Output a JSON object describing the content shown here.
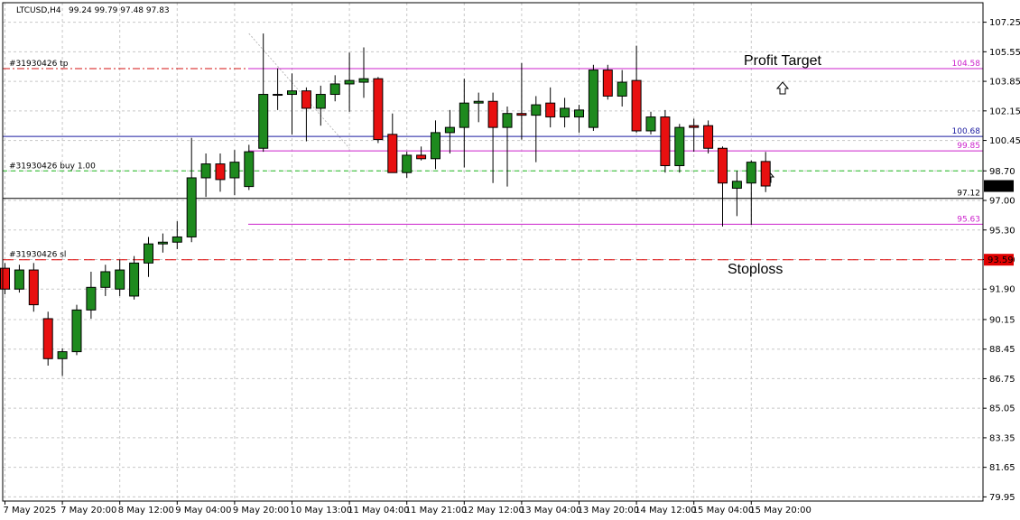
{
  "header": {
    "symbol": "LTCUSD,H4",
    "ohlc": "99.24 99.79 97.48 97.83"
  },
  "colors": {
    "bull": "#1e8a1e",
    "bear": "#e81010",
    "tp_line": "#d41010",
    "sl_line": "#e00000",
    "entry_line": "#22bb22",
    "magenta_line": "#cc22cc",
    "blue_line": "#1a1aa0",
    "price_line": "#000000",
    "grid": "#c8c8c8"
  },
  "chart_data": {
    "type": "candlestick",
    "ylim": [
      79.95,
      107.25
    ],
    "y_ticks": [
      "107.25",
      "105.55",
      "103.85",
      "102.15",
      "100.45",
      "98.70",
      "97.00",
      "95.30",
      "93.60",
      "91.90",
      "90.15",
      "88.45",
      "86.75",
      "85.05",
      "83.35",
      "81.65",
      "79.95"
    ],
    "x_ticks": [
      {
        "label": "7 May 2025",
        "i": 0
      },
      {
        "label": "7 May 20:00",
        "i": 4
      },
      {
        "label": "8 May 12:00",
        "i": 8
      },
      {
        "label": "9 May 04:00",
        "i": 12
      },
      {
        "label": "9 May 20:00",
        "i": 16
      },
      {
        "label": "10 May 13:00",
        "i": 20
      },
      {
        "label": "11 May 04:00",
        "i": 24
      },
      {
        "label": "11 May 21:00",
        "i": 28
      },
      {
        "label": "12 May 12:00",
        "i": 32
      },
      {
        "label": "13 May 04:00",
        "i": 36
      },
      {
        "label": "13 May 20:00",
        "i": 40
      },
      {
        "label": "14 May 12:00",
        "i": 44
      },
      {
        "label": "15 May 04:00",
        "i": 48
      },
      {
        "label": "15 May 20:00",
        "i": 52
      }
    ],
    "candles": [
      {
        "o": 93.1,
        "h": 93.4,
        "l": 91.6,
        "c": 91.9
      },
      {
        "o": 91.9,
        "h": 93.3,
        "l": 91.7,
        "c": 93.0
      },
      {
        "o": 93.0,
        "h": 93.4,
        "l": 90.6,
        "c": 91.0
      },
      {
        "o": 90.2,
        "h": 90.6,
        "l": 87.5,
        "c": 87.9
      },
      {
        "o": 87.9,
        "h": 88.5,
        "l": 86.9,
        "c": 88.3
      },
      {
        "o": 88.3,
        "h": 91.0,
        "l": 88.1,
        "c": 90.7
      },
      {
        "o": 90.7,
        "h": 92.9,
        "l": 90.2,
        "c": 92.0
      },
      {
        "o": 92.0,
        "h": 93.3,
        "l": 91.5,
        "c": 92.9
      },
      {
        "o": 91.9,
        "h": 93.6,
        "l": 91.5,
        "c": 93.0
      },
      {
        "o": 91.5,
        "h": 93.8,
        "l": 91.3,
        "c": 93.4
      },
      {
        "o": 93.4,
        "h": 94.9,
        "l": 92.6,
        "c": 94.5
      },
      {
        "o": 94.5,
        "h": 95.1,
        "l": 94.0,
        "c": 94.6
      },
      {
        "o": 94.6,
        "h": 95.8,
        "l": 94.2,
        "c": 94.9
      },
      {
        "o": 94.9,
        "h": 100.6,
        "l": 94.6,
        "c": 98.3
      },
      {
        "o": 98.3,
        "h": 99.7,
        "l": 97.2,
        "c": 99.1
      },
      {
        "o": 99.1,
        "h": 99.7,
        "l": 97.5,
        "c": 98.2
      },
      {
        "o": 98.3,
        "h": 99.9,
        "l": 97.3,
        "c": 99.2
      },
      {
        "o": 97.8,
        "h": 100.2,
        "l": 97.6,
        "c": 99.8
      },
      {
        "o": 100.0,
        "h": 106.6,
        "l": 99.8,
        "c": 103.1
      },
      {
        "o": 103.1,
        "h": 104.6,
        "l": 102.2,
        "c": 103.1
      },
      {
        "o": 103.1,
        "h": 104.3,
        "l": 100.8,
        "c": 103.3
      },
      {
        "o": 103.3,
        "h": 103.5,
        "l": 100.4,
        "c": 102.3
      },
      {
        "o": 102.3,
        "h": 103.6,
        "l": 101.3,
        "c": 103.1
      },
      {
        "o": 103.1,
        "h": 104.2,
        "l": 102.7,
        "c": 103.7
      },
      {
        "o": 103.7,
        "h": 105.5,
        "l": 102.1,
        "c": 103.9
      },
      {
        "o": 103.8,
        "h": 105.8,
        "l": 102.9,
        "c": 104.0
      },
      {
        "o": 104.0,
        "h": 104.1,
        "l": 100.3,
        "c": 100.5
      },
      {
        "o": 100.8,
        "h": 102.0,
        "l": 98.6,
        "c": 98.6
      },
      {
        "o": 98.6,
        "h": 99.8,
        "l": 98.3,
        "c": 99.6
      },
      {
        "o": 99.6,
        "h": 100.1,
        "l": 99.3,
        "c": 99.4
      },
      {
        "o": 99.4,
        "h": 101.6,
        "l": 98.8,
        "c": 100.9
      },
      {
        "o": 100.9,
        "h": 102.2,
        "l": 99.7,
        "c": 101.2
      },
      {
        "o": 101.2,
        "h": 104.0,
        "l": 98.9,
        "c": 102.6
      },
      {
        "o": 102.6,
        "h": 103.2,
        "l": 101.5,
        "c": 102.7
      },
      {
        "o": 102.7,
        "h": 103.2,
        "l": 98.0,
        "c": 101.2
      },
      {
        "o": 101.2,
        "h": 102.4,
        "l": 97.8,
        "c": 102.0
      },
      {
        "o": 102.0,
        "h": 104.9,
        "l": 100.5,
        "c": 101.9
      },
      {
        "o": 101.9,
        "h": 103.0,
        "l": 99.2,
        "c": 102.5
      },
      {
        "o": 102.6,
        "h": 103.5,
        "l": 101.2,
        "c": 101.8
      },
      {
        "o": 101.8,
        "h": 102.9,
        "l": 101.2,
        "c": 102.3
      },
      {
        "o": 101.8,
        "h": 102.5,
        "l": 100.9,
        "c": 102.2
      },
      {
        "o": 101.2,
        "h": 104.8,
        "l": 101.0,
        "c": 104.5
      },
      {
        "o": 104.5,
        "h": 104.8,
        "l": 102.8,
        "c": 103.0
      },
      {
        "o": 103.0,
        "h": 104.5,
        "l": 102.4,
        "c": 103.8
      },
      {
        "o": 103.9,
        "h": 105.9,
        "l": 100.9,
        "c": 101.0
      },
      {
        "o": 101.0,
        "h": 102.1,
        "l": 100.8,
        "c": 101.8
      },
      {
        "o": 101.8,
        "h": 102.2,
        "l": 98.6,
        "c": 99.0
      },
      {
        "o": 99.0,
        "h": 101.4,
        "l": 98.6,
        "c": 101.2
      },
      {
        "o": 101.3,
        "h": 101.7,
        "l": 99.8,
        "c": 101.2
      },
      {
        "o": 101.3,
        "h": 101.6,
        "l": 99.7,
        "c": 100.0
      },
      {
        "o": 100.0,
        "h": 100.1,
        "l": 95.5,
        "c": 98.0
      },
      {
        "o": 97.7,
        "h": 98.7,
        "l": 96.1,
        "c": 98.1
      },
      {
        "o": 98.0,
        "h": 99.3,
        "l": 95.6,
        "c": 99.2
      },
      {
        "o": 99.24,
        "h": 99.79,
        "l": 97.48,
        "c": 97.83
      }
    ],
    "levels": [
      {
        "name": "tp",
        "price": 104.58,
        "label": "#31930426 tp",
        "tag": "104.58"
      },
      {
        "name": "entry",
        "price": 98.7,
        "label": "#31930426 buy 1.00"
      },
      {
        "name": "sl",
        "price": 93.59,
        "label": "#31930426 sl",
        "tag": "93.59"
      },
      {
        "name": "blue",
        "price": 100.68,
        "tag": "100.68"
      },
      {
        "name": "mag_upper",
        "price": 99.85,
        "tag": "99.85"
      },
      {
        "name": "mag_lower",
        "price": 95.63,
        "tag": "95.63"
      },
      {
        "name": "black",
        "price": 97.12,
        "tag": "97.12"
      },
      {
        "name": "bid",
        "price": 97.83,
        "tag": "97.83"
      }
    ],
    "annotations": {
      "profit_target": "Profit Target",
      "stoploss": "Stoploss"
    }
  }
}
